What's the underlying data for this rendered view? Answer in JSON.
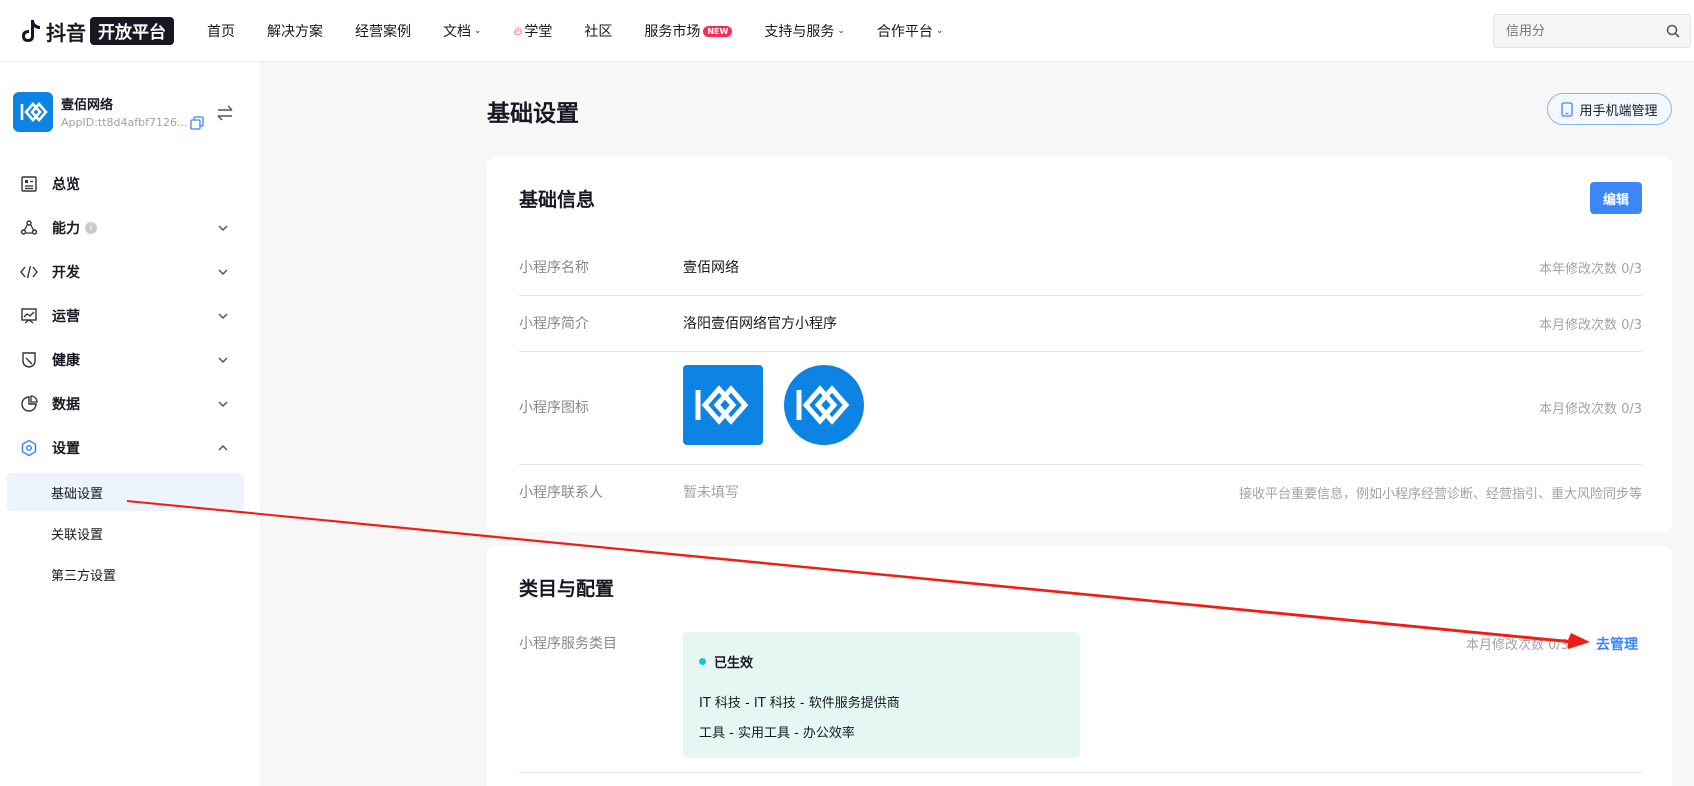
{
  "topbar": {
    "logo_text": "抖音",
    "logo_badge": "开放平台",
    "nav": [
      {
        "label": "首页",
        "chevron": false
      },
      {
        "label": "解决方案",
        "chevron": false
      },
      {
        "label": "经营案例",
        "chevron": false
      },
      {
        "label": "文档",
        "chevron": true
      },
      {
        "label": "学堂",
        "chevron": false,
        "fire": true
      },
      {
        "label": "社区",
        "chevron": false
      },
      {
        "label": "服务市场",
        "chevron": false,
        "badge": "NEW"
      },
      {
        "label": "支持与服务",
        "chevron": true
      },
      {
        "label": "合作平台",
        "chevron": true
      }
    ],
    "search_placeholder": "信用分"
  },
  "app": {
    "name": "壹佰网络",
    "app_id": "AppID:tt8d4afbf7126..."
  },
  "sidebar": {
    "items": [
      {
        "label": "总览",
        "icon": "overview-icon",
        "chevron": ""
      },
      {
        "label": "能力",
        "icon": "ability-icon",
        "chevron": "down",
        "info": true
      },
      {
        "label": "开发",
        "icon": "code-icon",
        "chevron": "down"
      },
      {
        "label": "运营",
        "icon": "operation-icon",
        "chevron": "down"
      },
      {
        "label": "健康",
        "icon": "health-icon",
        "chevron": "down"
      },
      {
        "label": "数据",
        "icon": "data-icon",
        "chevron": "down"
      },
      {
        "label": "设置",
        "icon": "settings-icon",
        "chevron": "up"
      }
    ],
    "sub_items": [
      {
        "label": "基础设置",
        "active": true
      },
      {
        "label": "关联设置",
        "active": false
      },
      {
        "label": "第三方设置",
        "active": false
      }
    ]
  },
  "page": {
    "title": "基础设置",
    "mobile_button": "用手机端管理"
  },
  "basic_info": {
    "title": "基础信息",
    "edit_button": "编辑",
    "rows": [
      {
        "label": "小程序名称",
        "value": "壹佰网络",
        "right": "本年修改次数 0/3"
      },
      {
        "label": "小程序简介",
        "value": "洛阳壹佰网络官方小程序",
        "right": "本月修改次数 0/3"
      },
      {
        "label": "小程序图标",
        "value": "",
        "right": "本月修改次数 0/3"
      },
      {
        "label": "小程序联系人",
        "value": "暂未填写",
        "right": "接收平台重要信息，例如小程序经营诊断、经营指引、重大风险同步等"
      }
    ]
  },
  "category": {
    "title": "类目与配置",
    "row_label": "小程序服务类目",
    "status": "已生效",
    "lines": [
      "IT 科技 - IT 科技 - 软件服务提供商",
      "工具 - 实用工具 - 办公效率"
    ],
    "right_text": "本月修改次数 0/3",
    "manage_link": "去管理"
  },
  "colors": {
    "brand": "#0d84e3",
    "primary": "#3d86f4",
    "annotation_arrow": "#f21d12"
  }
}
